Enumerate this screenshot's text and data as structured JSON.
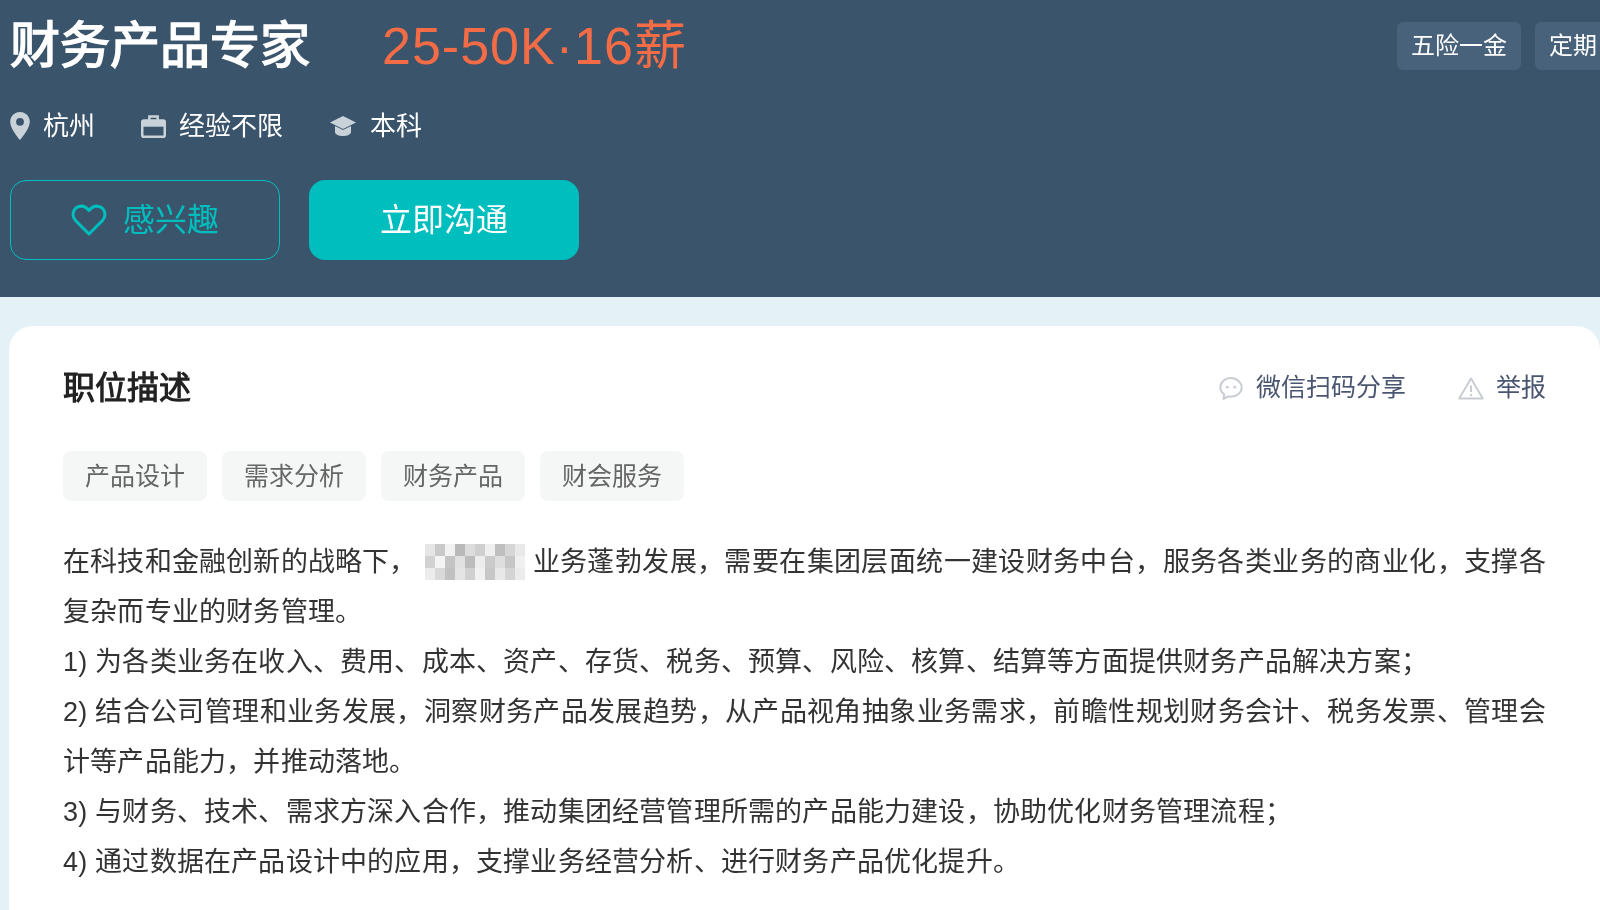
{
  "job": {
    "title": "财务产品专家",
    "salary": "25-50K·16薪",
    "benefits": [
      "五险一金",
      "定期"
    ],
    "meta": [
      {
        "kind": "location",
        "text": "杭州"
      },
      {
        "kind": "experience",
        "text": "经验不限"
      },
      {
        "kind": "education",
        "text": "本科"
      }
    ],
    "actions": [
      {
        "kind": "outline",
        "label": "感兴趣"
      },
      {
        "kind": "primary",
        "label": "立即沟通"
      }
    ]
  },
  "description": {
    "title": "职位描述",
    "share": "微信扫码分享",
    "report": "举报",
    "skills": [
      "产品设计",
      "需求分析",
      "财务产品",
      "财会服务"
    ],
    "paragraphs": [
      {
        "kind": "redacted",
        "before": "在科技和金融创新的战略下，",
        "after": "业务蓬勃发展，需要在集团层面统一建设财务中台，服务各类业务的商业化，支撑各"
      },
      {
        "kind": "plain",
        "text": "复杂而专业的财务管理。"
      },
      {
        "kind": "plain",
        "text": "1) 为各类业务在收入、费用、成本、资产、存货、税务、预算、风险、核算、结算等方面提供财务产品解决方案；"
      },
      {
        "kind": "plain",
        "text": "2) 结合公司管理和业务发展，洞察财务产品发展趋势，从产品视角抽象业务需求，前瞻性规划财务会计、税务发票、管理会计等产品能力，并推动落地。"
      },
      {
        "kind": "plain",
        "text": "3) 与财务、技术、需求方深入合作，推动集团经营管理所需的产品能力建设，协助优化财务管理流程；"
      },
      {
        "kind": "plain",
        "text": "4) 通过数据在产品设计中的应用，支撑业务经营分析、进行财务产品优化提升。"
      }
    ]
  }
}
